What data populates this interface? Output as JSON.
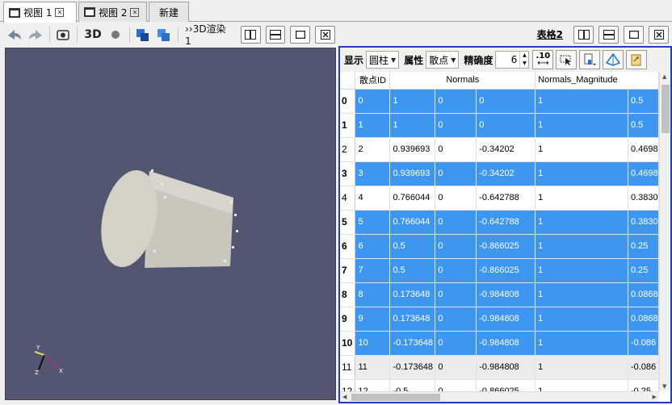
{
  "tabs": [
    {
      "label": "视图 1",
      "active": true
    },
    {
      "label": "视图 2",
      "active": false
    }
  ],
  "new_tab_label": "新建",
  "left_toolbar": {
    "label_3d": "3D",
    "renderer_label": "››3D渲染1"
  },
  "right_toolbar": {
    "table_title": "表格2"
  },
  "filter": {
    "show_label": "显示",
    "show_value": "圆柱",
    "attr_label": "属性",
    "attr_value": "散点",
    "precision_label": "精确度",
    "precision_value": "6",
    "fixed_label": ".10"
  },
  "table": {
    "headers": [
      "散点ID",
      "Normals",
      "Normals_Magnitude"
    ],
    "rows": [
      {
        "idx": "0",
        "cells": [
          "0",
          "1",
          "0",
          "0",
          "1",
          "0.5"
        ],
        "state": "sel"
      },
      {
        "idx": "1",
        "cells": [
          "1",
          "1",
          "0",
          "0",
          "1",
          "0.5"
        ],
        "state": "sel"
      },
      {
        "idx": "2",
        "cells": [
          "2",
          "0.939693",
          "0",
          "-0.34202",
          "1",
          "0.4698"
        ],
        "state": "plain"
      },
      {
        "idx": "3",
        "cells": [
          "3",
          "0.939693",
          "0",
          "-0.34202",
          "1",
          "0.4698"
        ],
        "state": "sel"
      },
      {
        "idx": "4",
        "cells": [
          "4",
          "0.766044",
          "0",
          "-0.642788",
          "1",
          "0.3830"
        ],
        "state": "plain"
      },
      {
        "idx": "5",
        "cells": [
          "5",
          "0.766044",
          "0",
          "-0.642788",
          "1",
          "0.3830"
        ],
        "state": "sel"
      },
      {
        "idx": "6",
        "cells": [
          "6",
          "0.5",
          "0",
          "-0.866025",
          "1",
          "0.25"
        ],
        "state": "sel"
      },
      {
        "idx": "7",
        "cells": [
          "7",
          "0.5",
          "0",
          "-0.866025",
          "1",
          "0.25"
        ],
        "state": "sel"
      },
      {
        "idx": "8",
        "cells": [
          "8",
          "0.173648",
          "0",
          "-0.984808",
          "1",
          "0.0868"
        ],
        "state": "sel"
      },
      {
        "idx": "9",
        "cells": [
          "9",
          "0.173648",
          "0",
          "-0.984808",
          "1",
          "0.0868"
        ],
        "state": "sel"
      },
      {
        "idx": "10",
        "cells": [
          "10",
          "-0.173648",
          "0",
          "-0.984808",
          "1",
          "-0.086"
        ],
        "state": "sel"
      },
      {
        "idx": "11",
        "cells": [
          "11",
          "-0.173648",
          "0",
          "-0.984808",
          "1",
          "-0.086"
        ],
        "state": "gray"
      },
      {
        "idx": "12",
        "cells": [
          "12",
          "-0.5",
          "0",
          "-0.866025",
          "1",
          "-0.25"
        ],
        "state": "plain"
      }
    ]
  },
  "colors": {
    "selection": "#3d97f0",
    "view_background": "#535670",
    "panel_border": "#1d3fc2"
  }
}
